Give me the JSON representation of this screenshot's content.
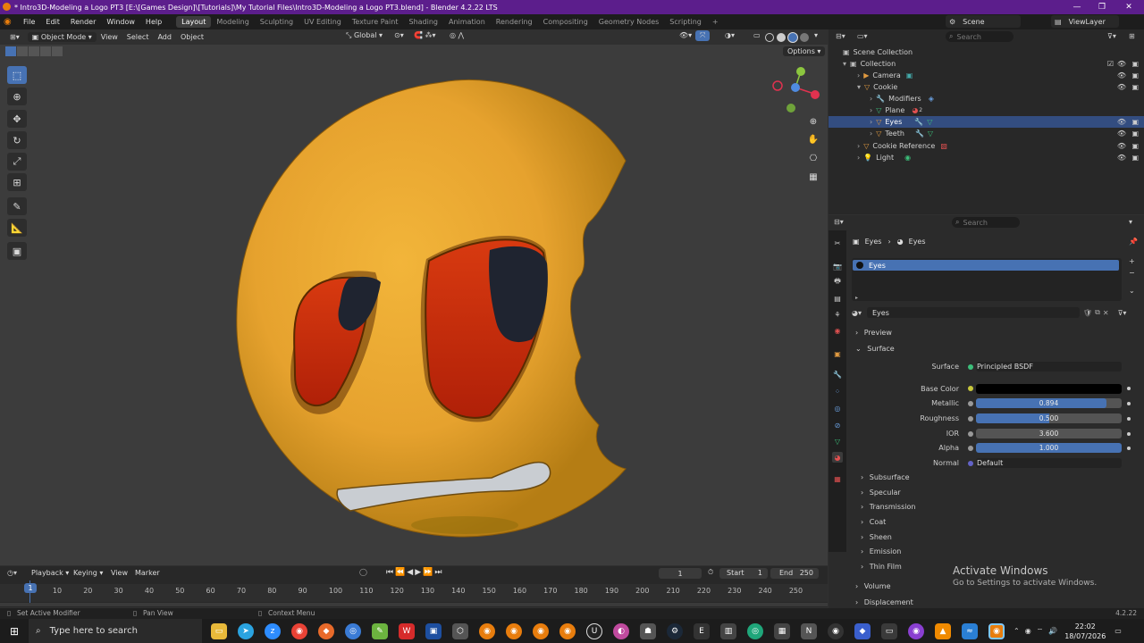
{
  "window": {
    "title": "* Intro3D-Modeling a Logo PT3 [E:\\[Games Design]\\[Tutorials]\\My Tutorial Files\\Intro3D-Modeling a Logo PT3.blend] - Blender 4.2.22 LTS",
    "minimize": "—",
    "restore": "❐",
    "close": "✕"
  },
  "menu": {
    "items": [
      "File",
      "Edit",
      "Render",
      "Window",
      "Help"
    ],
    "workspaces": [
      "Layout",
      "Modeling",
      "Sculpting",
      "UV Editing",
      "Texture Paint",
      "Shading",
      "Animation",
      "Rendering",
      "Compositing",
      "Geometry Nodes",
      "Scripting"
    ],
    "active_workspace": "Layout",
    "add_tab": "+",
    "scene": "Scene",
    "view_layer": "ViewLayer"
  },
  "viewport_header": {
    "mode": "Object Mode",
    "menus": [
      "View",
      "Select",
      "Add",
      "Object"
    ],
    "orientation": "Global",
    "options": "Options"
  },
  "outliner": {
    "search_placeholder": "Search",
    "rows": [
      {
        "label": "Scene Collection"
      },
      {
        "label": "Collection"
      },
      {
        "label": "Camera"
      },
      {
        "label": "Cookie"
      },
      {
        "label": "Modifiers"
      },
      {
        "label": "Plane"
      },
      {
        "label": "Eyes"
      },
      {
        "label": "Teeth"
      },
      {
        "label": "Cookie Reference"
      },
      {
        "label": "Light"
      }
    ],
    "plane_badge": "2"
  },
  "properties": {
    "search_placeholder": "Search",
    "breadcrumb": [
      "Eyes",
      "Eyes"
    ],
    "slot": "Eyes",
    "material_name": "Eyes",
    "sections": {
      "preview": "Preview",
      "surface": "Surface"
    },
    "surface": {
      "label": "Surface",
      "value": "Principled BSDF"
    },
    "fields": [
      {
        "label": "Base Color",
        "value": ""
      },
      {
        "label": "Metallic",
        "value": "0.894",
        "fraction": 0.894
      },
      {
        "label": "Roughness",
        "value": "0.500",
        "fraction": 0.5
      },
      {
        "label": "IOR",
        "value": "3.600",
        "fraction": 0.0
      },
      {
        "label": "Alpha",
        "value": "1.000",
        "fraction": 1.0
      },
      {
        "label": "Normal",
        "value": "Default"
      }
    ],
    "subsections": [
      "Subsurface",
      "Specular",
      "Transmission",
      "Coat",
      "Sheen",
      "Emission",
      "Thin Film"
    ],
    "bottom_sections": [
      "Volume",
      "Displacement"
    ],
    "colors": {
      "base_color": "#000000",
      "accent": "#4772b3"
    }
  },
  "watermark": {
    "line1": "Activate Windows",
    "line2": "Go to Settings to activate Windows."
  },
  "timeline": {
    "menus": [
      "Playback",
      "Keying",
      "View",
      "Marker"
    ],
    "current_frame": "1",
    "start_label": "Start",
    "start": "1",
    "end_label": "End",
    "end": "250",
    "ruler": [
      "1",
      "10",
      "20",
      "30",
      "40",
      "50",
      "60",
      "70",
      "80",
      "90",
      "100",
      "110",
      "120",
      "130",
      "140",
      "150",
      "160",
      "170",
      "180",
      "190",
      "200",
      "210",
      "220",
      "230",
      "240",
      "250"
    ]
  },
  "statusbar": {
    "left": "Set Active Modifier",
    "mid": "Pan View",
    "right": "Context Menu",
    "version": "4.2.22"
  },
  "taskbar": {
    "search_placeholder": "Type here to search",
    "time": "22:02",
    "date": "18/07/2026"
  }
}
